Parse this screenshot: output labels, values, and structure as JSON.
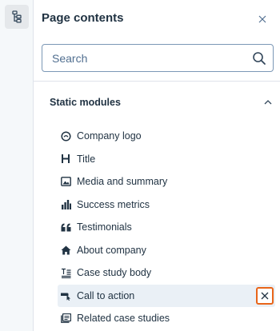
{
  "panel": {
    "title": "Page contents",
    "search_placeholder": "Search"
  },
  "section": {
    "title": "Static modules",
    "expanded": true
  },
  "modules": [
    {
      "label": "Company logo",
      "icon": "logo-icon"
    },
    {
      "label": "Title",
      "icon": "heading-icon"
    },
    {
      "label": "Media and summary",
      "icon": "image-icon"
    },
    {
      "label": "Success metrics",
      "icon": "bar-chart-icon"
    },
    {
      "label": "Testimonials",
      "icon": "quote-icon"
    },
    {
      "label": "About company",
      "icon": "home-icon"
    },
    {
      "label": "Case study body",
      "icon": "text-format-icon"
    },
    {
      "label": "Call to action",
      "icon": "cta-icon",
      "selected": true
    },
    {
      "label": "Related case studies",
      "icon": "related-list-icon"
    }
  ],
  "colors": {
    "accent_highlight": "#e8651a",
    "selected_row": "#eaf0f6",
    "text": "#213343"
  }
}
